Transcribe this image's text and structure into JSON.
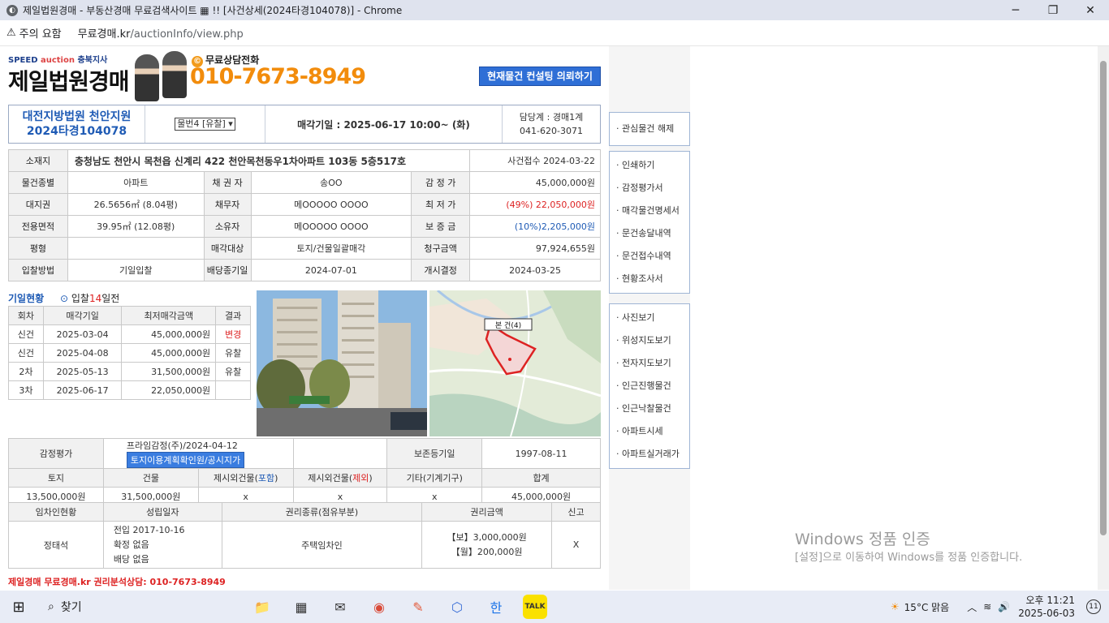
{
  "browser": {
    "title": "제일법원경매 - 부동산경매 무료검색사이트 ▦ !! [사건상세(2024타경104078)] - Chrome",
    "warning": "주의 요함",
    "url_domain": "무료경매.kr",
    "url_path": "/auctionInfo/view.php",
    "min": "─",
    "max": "❐",
    "close": "✕"
  },
  "header": {
    "logo_sub_prefix": "SPEED",
    "logo_sub_brand": "auction",
    "logo_sub_branch": "충북지사",
    "logo_main": "제일법원경매",
    "phone_label": "무료상담전화",
    "phone_number": "010-7673-8949",
    "consult_button": "현재물건 컨설팅 의뢰하기"
  },
  "case": {
    "court": "대전지방법원 천안지원",
    "case_no": "2024타경104078",
    "item_select": "물번4 [유찰]",
    "sale_date": "매각기일 : 2025-06-17  10:00~ (화)",
    "dept": "담당계 : 경매1계",
    "dept_phone": "041-620-3071"
  },
  "details": {
    "loc_label": "소재지",
    "address": "충청남도 천안시 목천읍 신계리 422 천안목천동우1차아파트 103동 5층517호",
    "received": "사건접수 2024-03-22",
    "rows": [
      [
        "물건종별",
        "아파트",
        "채 권 자",
        "송OO",
        "감 정 가",
        "45,000,000원"
      ],
      [
        "대지권",
        "26.5656㎡ (8.04평)",
        "채무자",
        "메OOOOO OOOO",
        "최 저 가",
        "(49%) 22,050,000원"
      ],
      [
        "전용면적",
        "39.95㎡ (12.08평)",
        "소유자",
        "메OOOOO OOOO",
        "보 증 금",
        "(10%)2,205,000원"
      ],
      [
        "평형",
        "",
        "매각대상",
        "토지/건물일괄매각",
        "청구금액",
        "97,924,655원"
      ],
      [
        "입찰방법",
        "기일입찰",
        "배당종기일",
        "2024-07-01",
        "개시결정",
        "2024-03-25"
      ]
    ]
  },
  "schedule": {
    "title": "기일현황",
    "note_prefix": "입찰",
    "note_days": "14",
    "note_suffix": "일전",
    "headers": [
      "회차",
      "매각기일",
      "최저매각금액",
      "결과"
    ],
    "rows": [
      [
        "신건",
        "2025-03-04",
        "45,000,000원",
        "변경"
      ],
      [
        "신건",
        "2025-04-08",
        "45,000,000원",
        "유찰"
      ],
      [
        "2차",
        "2025-05-13",
        "31,500,000원",
        "유찰"
      ],
      [
        "3차",
        "2025-06-17",
        "22,050,000원",
        ""
      ]
    ]
  },
  "map": {
    "label": "본 건(4)"
  },
  "appraisal": {
    "label": "감정평가",
    "value": "프라임감정(주)/2024-04-12",
    "button": "토지이용계획확인원/공시지가",
    "preserve_label": "보존등기일",
    "preserve_value": "1997-08-11",
    "headers": [
      "토지",
      "건물",
      "제시외건물",
      "포함",
      "제시외건물",
      "제외",
      "기타(기계기구)",
      "합계"
    ],
    "values": [
      "13,500,000원",
      "31,500,000원",
      "x",
      "x",
      "x",
      "45,000,000원"
    ]
  },
  "tenant": {
    "headers": [
      "임차인현황",
      "성립일자",
      "권리종류(점유부분)",
      "권리금액",
      "신고"
    ],
    "name": "정태석",
    "date1": "전입 2017-10-16",
    "date2": "확정 없음",
    "date3": "배당 없음",
    "type": "주택임차인",
    "amount1": "【보】3,000,000원",
    "amount2": "【월】200,000원",
    "report": "X"
  },
  "footer": {
    "brand": "제일경매",
    "text": " 무료경매.kr 권리분석상담: 010-7673-8949"
  },
  "sidebar": {
    "group1": [
      "· 관심물건 해제"
    ],
    "group2": [
      "· 인쇄하기",
      "· 감정평가서",
      "·  매각물건명세서",
      "· 문건송달내역",
      "· 문건접수내역",
      "· 현황조사서"
    ],
    "group3": [
      "· 사진보기",
      "· 위성지도보기",
      "· 전자지도보기",
      "· 인근진행물건",
      "· 인근낙찰물건",
      "· 아파트시세",
      "· 아파트실거래가"
    ]
  },
  "watermark": {
    "line1": "Windows 정품 인증",
    "line2": "[설정]으로 이동하여 Windows를 정품 인증합니다."
  },
  "taskbar": {
    "search": "찾기",
    "weather": "15°C  맑음",
    "time": "오후 11:21",
    "date": "2025-06-03",
    "notif": "11"
  }
}
